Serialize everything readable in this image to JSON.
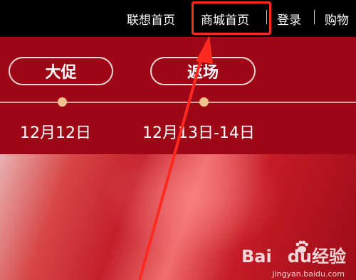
{
  "topbar": {
    "lenovo_home": "联想首页",
    "mall_home": "商城首页",
    "login": "登录",
    "cart_partial": "购物"
  },
  "promo": {
    "phase1_label": "大促",
    "phase1_date": "12月12日",
    "phase2_label": "返场",
    "phase2_date": "12月13日-14日"
  },
  "watermark": {
    "brand": "Bai",
    "brand2": "du",
    "product": "经验",
    "url": "jingyan.baidu.com"
  },
  "colors": {
    "topbar": "#000000",
    "banner": "#9e0816",
    "highlight": "#ff2a1f",
    "timeline_dot": "#f0c28f"
  }
}
